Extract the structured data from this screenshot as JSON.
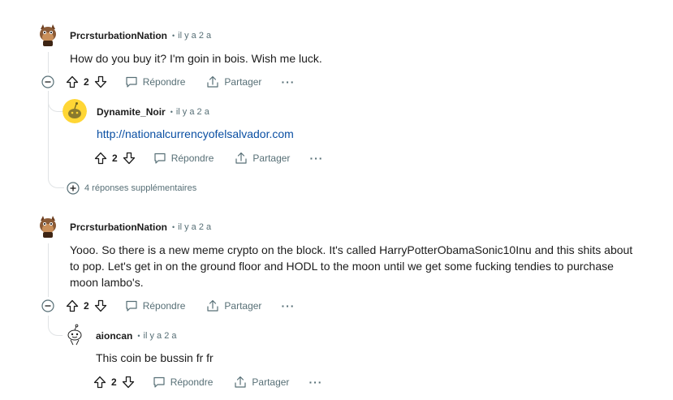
{
  "comments": [
    {
      "author": "PrcrsturbationNation",
      "time": "il y a 2 a",
      "text": "How do you buy it? I'm goin in bois. Wish me luck.",
      "votes": "2",
      "reply_label": "Répondre",
      "share_label": "Partager",
      "more_label": "···"
    },
    {
      "author": "Dynamite_Noir",
      "time": "il y a 2 a",
      "link": "http://nationalcurrencyofelsalvador.com",
      "votes": "2",
      "reply_label": "Répondre",
      "share_label": "Partager",
      "more_label": "···"
    },
    {
      "author": "PrcrsturbationNation",
      "time": "il y a 2 a",
      "text_lines": [
        "Yooo. So there is a new meme crypto on the block. It's called HarryPotterObamaSonic10Inu and this shits about",
        "to pop. Let's get in on the ground floor and HODL to the moon until we get some fucking tendies to purchase",
        "moon lambo's."
      ],
      "votes": "2",
      "reply_label": "Répondre",
      "share_label": "Partager",
      "more_label": "···"
    },
    {
      "author": "aioncan",
      "time": "il y a 2 a",
      "text": "This coin be bussin fr fr",
      "votes": "2",
      "reply_label": "Répondre",
      "share_label": "Partager",
      "more_label": "···"
    }
  ],
  "more_replies_label": "4 réponses supplémentaires",
  "icons": {
    "collapse": "collapse-minus-icon",
    "upvote": "upvote-arrow-icon",
    "downvote": "downvote-arrow-icon",
    "reply": "speech-bubble-icon",
    "share": "share-upload-icon",
    "expand": "expand-plus-icon"
  },
  "colors": {
    "text": "#1c1c1c",
    "meta": "#576f76",
    "link": "#0a4fa3",
    "thread_line": "#e0e3e5"
  }
}
